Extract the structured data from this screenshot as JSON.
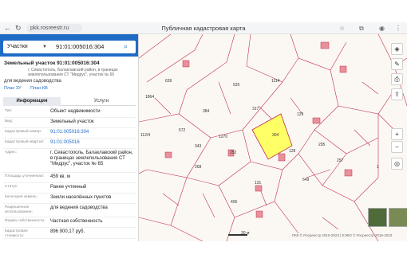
{
  "browser": {
    "url": "pkk.rosreestr.ru",
    "page_title": "Публичная кадастровая карта"
  },
  "search": {
    "type_label": "Участки",
    "value": "91:01:005016:304"
  },
  "object": {
    "title": "Земельный участок 91:01:005016:304",
    "address_note": "г. Севастополь, Балаклавский район, в границах землепользования СТ \"Мидрус\", участок № 65",
    "use": "для ведения садоводства",
    "links": [
      "План ЗУ",
      "План КВ"
    ]
  },
  "tabs": {
    "info": "Информация",
    "services": "Услуги"
  },
  "info_rows": [
    {
      "label": "Тип:",
      "value": "Объект недвижимости",
      "link": false
    },
    {
      "label": "Вид:",
      "value": "Земельный участок",
      "link": false
    },
    {
      "label": "Кадастровый номер:",
      "value": "91:01:005016:304",
      "link": true
    },
    {
      "label": "Кадастровый квартал:",
      "value": "91:01:005016",
      "link": true
    },
    {
      "label": "Адрес:",
      "value": "г. Севастополь, Балаклавский район, в границах землепользования СТ \"Мидрус\", участок № 65",
      "link": false
    },
    {
      "label": "Площадь уточненная:",
      "value": "459 кв. м",
      "link": false
    },
    {
      "label": "Статус:",
      "value": "Ранее учтенный",
      "link": false
    },
    {
      "label": "Категория земель:",
      "value": "Земли населённых пунктов",
      "link": false
    },
    {
      "label": "Разрешенное использование:",
      "value": "для ведения садоводства",
      "link": false
    },
    {
      "label": "Форма собственности:",
      "value": "Частная собственность",
      "link": false
    },
    {
      "label": "Кадастровая стоимость:",
      "value": "896 900,17 руб.",
      "link": false
    }
  ],
  "map": {
    "parcel_labels": [
      "639",
      "1114",
      "526",
      "317",
      "304",
      "1864",
      "384",
      "129",
      "572",
      "1270",
      "112/4",
      "343",
      "268",
      "128",
      "295",
      "252",
      "257",
      "405",
      "131",
      "649",
      "1"
    ],
    "scale_text": "30 м",
    "attribution": "ПКК © Росреестр 2010-2023 | ЕЭКО © Росреестр 2016-2023",
    "selected_color": "#ffff66",
    "boundary_color": "#c0304a",
    "building_color": "#e8909b"
  }
}
